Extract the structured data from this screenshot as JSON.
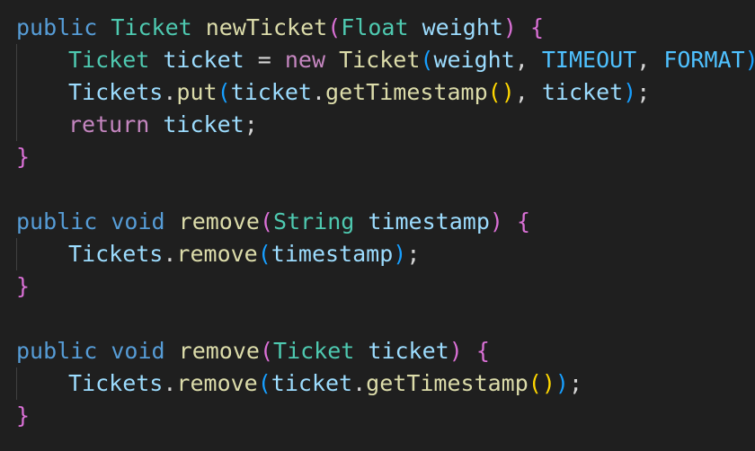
{
  "editor": {
    "lines": [
      {
        "guide": false,
        "tokens": [
          {
            "text": "public",
            "cls": "kw-blue"
          },
          {
            "text": " ",
            "cls": "punc"
          },
          {
            "text": "Ticket",
            "cls": "type"
          },
          {
            "text": " ",
            "cls": "punc"
          },
          {
            "text": "newTicket",
            "cls": "fn"
          },
          {
            "text": "(",
            "cls": "br2"
          },
          {
            "text": "Float",
            "cls": "type"
          },
          {
            "text": " ",
            "cls": "punc"
          },
          {
            "text": "weight",
            "cls": "var"
          },
          {
            "text": ")",
            "cls": "br2"
          },
          {
            "text": " ",
            "cls": "punc"
          },
          {
            "text": "{",
            "cls": "br2"
          }
        ]
      },
      {
        "guide": true,
        "tokens": [
          {
            "text": "Ticket",
            "cls": "type"
          },
          {
            "text": " ",
            "cls": "punc"
          },
          {
            "text": "ticket",
            "cls": "var"
          },
          {
            "text": " = ",
            "cls": "punc"
          },
          {
            "text": "new",
            "cls": "kw-purple"
          },
          {
            "text": " ",
            "cls": "punc"
          },
          {
            "text": "Ticket",
            "cls": "fn"
          },
          {
            "text": "(",
            "cls": "br3"
          },
          {
            "text": "weight",
            "cls": "var"
          },
          {
            "text": ", ",
            "cls": "punc"
          },
          {
            "text": "TIMEOUT",
            "cls": "const"
          },
          {
            "text": ", ",
            "cls": "punc"
          },
          {
            "text": "FORMAT",
            "cls": "const"
          },
          {
            "text": ")",
            "cls": "br3"
          },
          {
            "text": ";",
            "cls": "punc"
          }
        ]
      },
      {
        "guide": true,
        "tokens": [
          {
            "text": "Tickets",
            "cls": "var"
          },
          {
            "text": ".",
            "cls": "punc"
          },
          {
            "text": "put",
            "cls": "fn"
          },
          {
            "text": "(",
            "cls": "br3"
          },
          {
            "text": "ticket",
            "cls": "var"
          },
          {
            "text": ".",
            "cls": "punc"
          },
          {
            "text": "getTimestamp",
            "cls": "fn"
          },
          {
            "text": "()",
            "cls": "br1"
          },
          {
            "text": ", ",
            "cls": "punc"
          },
          {
            "text": "ticket",
            "cls": "var"
          },
          {
            "text": ")",
            "cls": "br3"
          },
          {
            "text": ";",
            "cls": "punc"
          }
        ]
      },
      {
        "guide": true,
        "tokens": [
          {
            "text": "return",
            "cls": "kw-purple"
          },
          {
            "text": " ",
            "cls": "punc"
          },
          {
            "text": "ticket",
            "cls": "var"
          },
          {
            "text": ";",
            "cls": "punc"
          }
        ]
      },
      {
        "guide": false,
        "tokens": [
          {
            "text": "}",
            "cls": "br2"
          }
        ]
      },
      {
        "guide": false,
        "tokens": []
      },
      {
        "guide": false,
        "tokens": [
          {
            "text": "public",
            "cls": "kw-blue"
          },
          {
            "text": " ",
            "cls": "punc"
          },
          {
            "text": "void",
            "cls": "kw-blue"
          },
          {
            "text": " ",
            "cls": "punc"
          },
          {
            "text": "remove",
            "cls": "fn"
          },
          {
            "text": "(",
            "cls": "br2"
          },
          {
            "text": "String",
            "cls": "type"
          },
          {
            "text": " ",
            "cls": "punc"
          },
          {
            "text": "timestamp",
            "cls": "var"
          },
          {
            "text": ")",
            "cls": "br2"
          },
          {
            "text": " ",
            "cls": "punc"
          },
          {
            "text": "{",
            "cls": "br2"
          }
        ]
      },
      {
        "guide": true,
        "tokens": [
          {
            "text": "Tickets",
            "cls": "var"
          },
          {
            "text": ".",
            "cls": "punc"
          },
          {
            "text": "remove",
            "cls": "fn"
          },
          {
            "text": "(",
            "cls": "br3"
          },
          {
            "text": "timestamp",
            "cls": "var"
          },
          {
            "text": ")",
            "cls": "br3"
          },
          {
            "text": ";",
            "cls": "punc"
          }
        ]
      },
      {
        "guide": false,
        "tokens": [
          {
            "text": "}",
            "cls": "br2"
          }
        ]
      },
      {
        "guide": false,
        "tokens": []
      },
      {
        "guide": false,
        "tokens": [
          {
            "text": "public",
            "cls": "kw-blue"
          },
          {
            "text": " ",
            "cls": "punc"
          },
          {
            "text": "void",
            "cls": "kw-blue"
          },
          {
            "text": " ",
            "cls": "punc"
          },
          {
            "text": "remove",
            "cls": "fn"
          },
          {
            "text": "(",
            "cls": "br2"
          },
          {
            "text": "Ticket",
            "cls": "type"
          },
          {
            "text": " ",
            "cls": "punc"
          },
          {
            "text": "ticket",
            "cls": "var"
          },
          {
            "text": ")",
            "cls": "br2"
          },
          {
            "text": " ",
            "cls": "punc"
          },
          {
            "text": "{",
            "cls": "br2"
          }
        ]
      },
      {
        "guide": true,
        "tokens": [
          {
            "text": "Tickets",
            "cls": "var"
          },
          {
            "text": ".",
            "cls": "punc"
          },
          {
            "text": "remove",
            "cls": "fn"
          },
          {
            "text": "(",
            "cls": "br3"
          },
          {
            "text": "ticket",
            "cls": "var"
          },
          {
            "text": ".",
            "cls": "punc"
          },
          {
            "text": "getTimestamp",
            "cls": "fn"
          },
          {
            "text": "()",
            "cls": "br1"
          },
          {
            "text": ")",
            "cls": "br3"
          },
          {
            "text": ";",
            "cls": "punc"
          }
        ]
      },
      {
        "guide": false,
        "tokens": [
          {
            "text": "}",
            "cls": "br2"
          }
        ]
      }
    ]
  }
}
